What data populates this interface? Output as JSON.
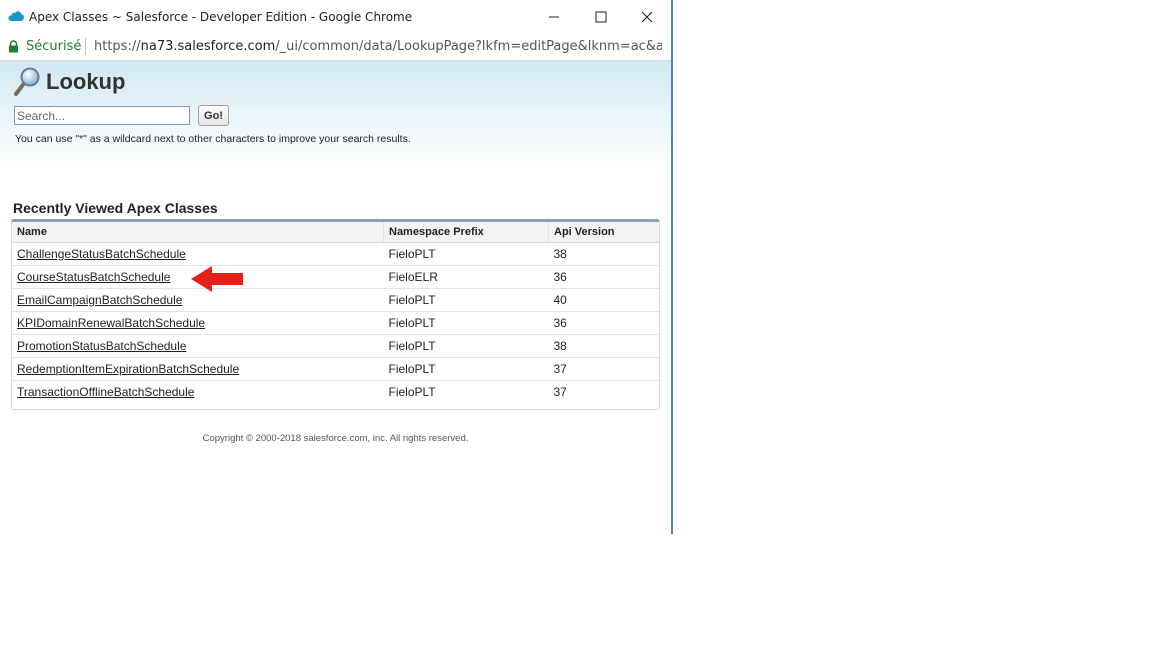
{
  "window": {
    "title": "Apex Classes ~ Salesforce - Developer Edition - Google Chrome",
    "secure_label": "Sécurisé",
    "url_scheme": "https://",
    "url_domain": "na73.salesforce.com",
    "url_path": "/_ui/common/data/LookupPage?lkfm=editPage&lknm=ac&ap..."
  },
  "lookup": {
    "title": "Lookup",
    "search_placeholder": "Search...",
    "go_label": "Go!",
    "hint": "You can use \"*\" as a wildcard next to other characters to improve your search results."
  },
  "recent": {
    "title": "Recently Viewed Apex Classes",
    "columns": [
      "Name",
      "Namespace Prefix",
      "Api Version"
    ],
    "rows": [
      {
        "name": "ChallengeStatusBatchSchedule",
        "prefix": "FieloPLT",
        "api": "38"
      },
      {
        "name": "CourseStatusBatchSchedule",
        "prefix": "FieloELR",
        "api": "36"
      },
      {
        "name": "EmailCampaignBatchSchedule",
        "prefix": "FieloPLT",
        "api": "40"
      },
      {
        "name": "KPIDomainRenewalBatchSchedule",
        "prefix": "FieloPLT",
        "api": "36"
      },
      {
        "name": "PromotionStatusBatchSchedule",
        "prefix": "FieloPLT",
        "api": "38"
      },
      {
        "name": "RedemptionItemExpirationBatchSchedule",
        "prefix": "FieloPLT",
        "api": "37"
      },
      {
        "name": "TransactionOfflineBatchSchedule",
        "prefix": "FieloPLT",
        "api": "37"
      }
    ]
  },
  "footer": "Copyright © 2000-2018 salesforce.com, inc. All rights reserved.",
  "colors": {
    "accent_blue": "#8a9ebe",
    "annotation_red": "#e32119",
    "secure_green": "#1e7c34"
  },
  "icons": [
    "salesforce-cloud-icon",
    "minimize-icon",
    "maximize-icon",
    "close-icon",
    "lock-icon",
    "magnifier-icon",
    "red-arrow-icon"
  ]
}
